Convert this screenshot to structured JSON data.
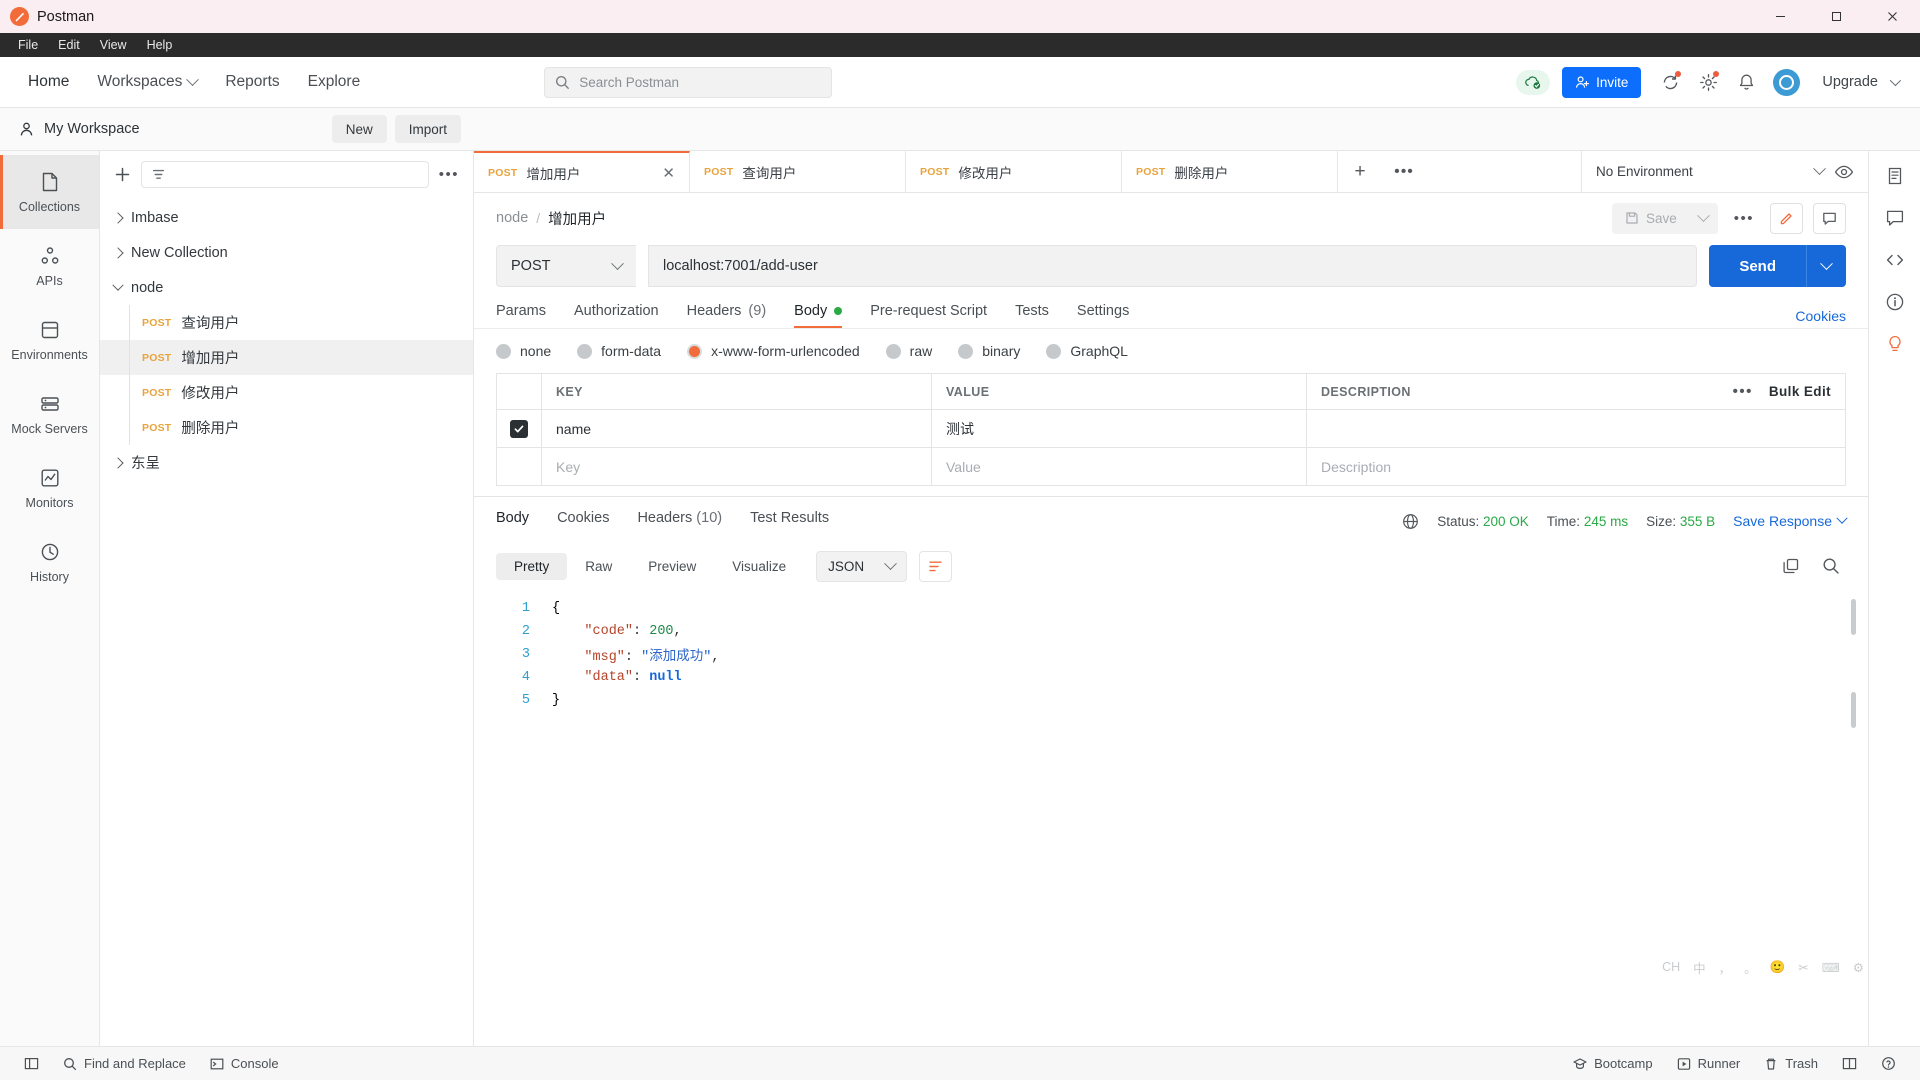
{
  "titlebar": {
    "app_name": "Postman",
    "minimize": "—",
    "maximize": "▢",
    "close": "✕"
  },
  "menubar": {
    "items": [
      "File",
      "Edit",
      "View",
      "Help"
    ]
  },
  "topnav": {
    "home": "Home",
    "workspaces": "Workspaces",
    "reports": "Reports",
    "explore": "Explore",
    "search_placeholder": "Search Postman",
    "invite": "Invite",
    "upgrade": "Upgrade"
  },
  "workspace_bar": {
    "name": "My Workspace",
    "new_label": "New",
    "import_label": "Import"
  },
  "rail": {
    "items": [
      {
        "label": "Collections",
        "icon": "collections-icon",
        "active": true
      },
      {
        "label": "APIs",
        "icon": "apis-icon",
        "active": false
      },
      {
        "label": "Environments",
        "icon": "environments-icon",
        "active": false
      },
      {
        "label": "Mock Servers",
        "icon": "mock-servers-icon",
        "active": false
      },
      {
        "label": "Monitors",
        "icon": "monitors-icon",
        "active": false
      },
      {
        "label": "History",
        "icon": "history-icon",
        "active": false
      }
    ]
  },
  "collections": {
    "tree": [
      {
        "label": "Imbase",
        "type": "collection",
        "expanded": false
      },
      {
        "label": "New Collection",
        "type": "collection",
        "expanded": false
      },
      {
        "label": "node",
        "type": "collection",
        "expanded": true
      },
      {
        "label": "查询用户",
        "type": "request",
        "method": "POST",
        "selected": false
      },
      {
        "label": "增加用户",
        "type": "request",
        "method": "POST",
        "selected": true
      },
      {
        "label": "修改用户",
        "type": "request",
        "method": "POST",
        "selected": false
      },
      {
        "label": "删除用户",
        "type": "request",
        "method": "POST",
        "selected": false
      },
      {
        "label": "东呈",
        "type": "collection",
        "expanded": false
      }
    ]
  },
  "tabs": {
    "open": [
      {
        "method": "POST",
        "label": "增加用户",
        "active": true
      },
      {
        "method": "POST",
        "label": "查询用户",
        "active": false
      },
      {
        "method": "POST",
        "label": "修改用户",
        "active": false
      },
      {
        "method": "POST",
        "label": "删除用户",
        "active": false
      }
    ],
    "environment": "No Environment"
  },
  "request": {
    "breadcrumb_root": "node",
    "breadcrumb_sep": "/",
    "breadcrumb_current": "增加用户",
    "save_label": "Save",
    "method": "POST",
    "url": "localhost:7001/add-user",
    "send_label": "Send",
    "tabs": [
      {
        "label": "Params",
        "active": false
      },
      {
        "label": "Authorization",
        "active": false
      },
      {
        "label": "Headers",
        "count": "(9)",
        "active": false
      },
      {
        "label": "Body",
        "active": true,
        "dot": true
      },
      {
        "label": "Pre-request Script",
        "active": false
      },
      {
        "label": "Tests",
        "active": false
      },
      {
        "label": "Settings",
        "active": false
      }
    ],
    "cookies_link": "Cookies",
    "body_types": [
      {
        "label": "none",
        "selected": false
      },
      {
        "label": "form-data",
        "selected": false
      },
      {
        "label": "x-www-form-urlencoded",
        "selected": true
      },
      {
        "label": "raw",
        "selected": false
      },
      {
        "label": "binary",
        "selected": false
      },
      {
        "label": "GraphQL",
        "selected": false
      }
    ],
    "table": {
      "headers": [
        "KEY",
        "VALUE",
        "DESCRIPTION"
      ],
      "bulk_edit": "Bulk Edit",
      "rows": [
        {
          "checked": true,
          "key": "name",
          "value": "测试",
          "description": ""
        }
      ],
      "placeholder_row": {
        "key": "Key",
        "value": "Value",
        "description": "Description"
      }
    }
  },
  "response": {
    "tabs": [
      {
        "label": "Body",
        "active": true
      },
      {
        "label": "Cookies",
        "active": false
      },
      {
        "label": "Headers",
        "count": "(10)",
        "active": false
      },
      {
        "label": "Test Results",
        "active": false
      }
    ],
    "status_label": "Status:",
    "status_value": "200 OK",
    "time_label": "Time:",
    "time_value": "245 ms",
    "size_label": "Size:",
    "size_value": "355 B",
    "save_response": "Save Response",
    "formats": [
      {
        "label": "Pretty",
        "active": true
      },
      {
        "label": "Raw",
        "active": false
      },
      {
        "label": "Preview",
        "active": false
      },
      {
        "label": "Visualize",
        "active": false
      }
    ],
    "content_type": "JSON",
    "body_lines": [
      {
        "n": "1",
        "html": "{"
      },
      {
        "n": "2",
        "html": "    <span class='k-key'>\"code\"</span><span class='k-pn'>: </span><span class='k-num'>200</span><span class='k-pn'>,</span>"
      },
      {
        "n": "3",
        "html": "    <span class='k-key'>\"msg\"</span><span class='k-pn'>: </span><span class='k-str'>\"添加成功\"</span><span class='k-pn'>,</span>"
      },
      {
        "n": "4",
        "html": "    <span class='k-key'>\"data\"</span><span class='k-pn'>: </span><span class='k-null'>null</span>"
      },
      {
        "n": "5",
        "html": "}"
      }
    ]
  },
  "statusbar": {
    "find_replace": "Find and Replace",
    "console": "Console",
    "bootcamp": "Bootcamp",
    "runner": "Runner",
    "trash": "Trash"
  },
  "ime": {
    "items": [
      "CH",
      "中",
      "，",
      "。",
      "🙂",
      "✂",
      "⌨",
      "⚙"
    ]
  },
  "colors": {
    "accent_orange": "#f26b3a",
    "blue": "#1769d9",
    "green": "#2aa946",
    "method_post": "#e8a33d"
  }
}
